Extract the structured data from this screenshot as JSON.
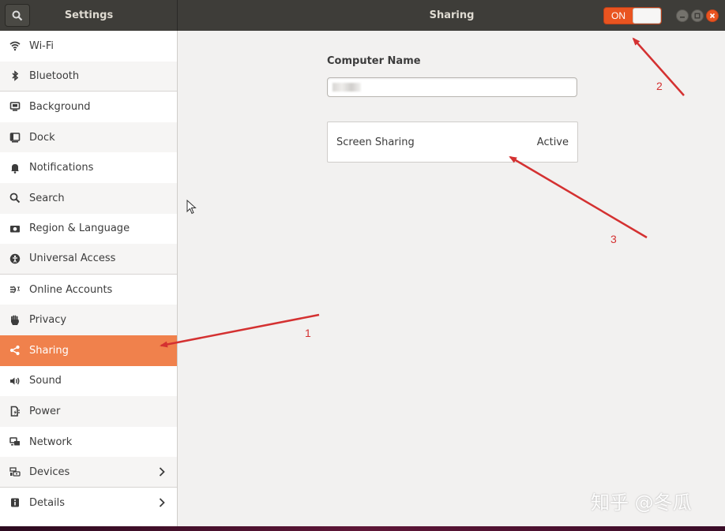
{
  "header": {
    "left_title": "Settings",
    "main_title": "Sharing",
    "master_switch_label": "ON"
  },
  "sidebar": {
    "items": [
      {
        "label": "Wi-Fi",
        "icon": "wifi-icon"
      },
      {
        "label": "Bluetooth",
        "icon": "bluetooth-icon"
      },
      {
        "label": "Background",
        "icon": "background-icon"
      },
      {
        "label": "Dock",
        "icon": "dock-icon"
      },
      {
        "label": "Notifications",
        "icon": "bell-icon"
      },
      {
        "label": "Search",
        "icon": "search-icon"
      },
      {
        "label": "Region & Language",
        "icon": "camera-icon"
      },
      {
        "label": "Universal Access",
        "icon": "accessibility-icon"
      },
      {
        "label": "Online Accounts",
        "icon": "online-accounts-icon"
      },
      {
        "label": "Privacy",
        "icon": "hand-icon"
      },
      {
        "label": "Sharing",
        "icon": "share-icon"
      },
      {
        "label": "Sound",
        "icon": "speaker-icon"
      },
      {
        "label": "Power",
        "icon": "power-icon"
      },
      {
        "label": "Network",
        "icon": "network-icon"
      },
      {
        "label": "Devices",
        "icon": "devices-icon"
      },
      {
        "label": "Details",
        "icon": "info-icon"
      }
    ]
  },
  "main": {
    "computer_name_label": "Computer Name",
    "computer_name_value": "",
    "screen_sharing": {
      "label": "Screen Sharing",
      "status": "Active"
    }
  },
  "annotations": {
    "one": "1",
    "two": "2",
    "three": "3"
  },
  "watermark": "知乎 @冬瓜",
  "colors": {
    "accent": "#e95420",
    "selected": "#f0814c",
    "arrow": "#d43131",
    "headerbar": "#3e3d39"
  }
}
